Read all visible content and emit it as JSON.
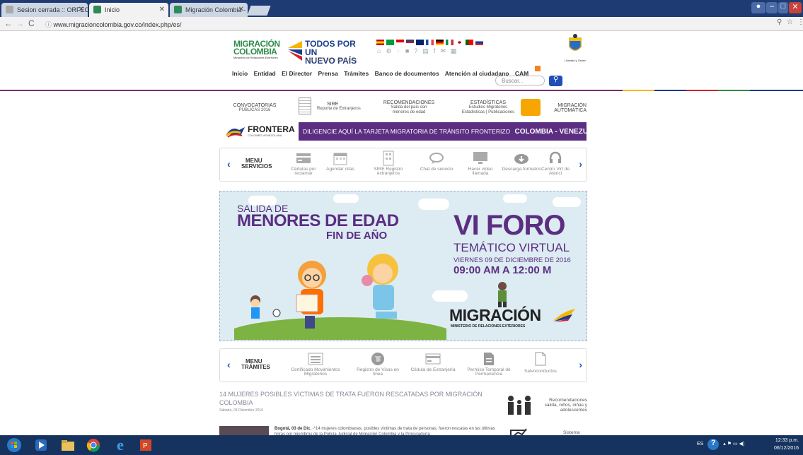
{
  "browser": {
    "tabs": [
      {
        "title": "Sesion cerrada :: ORFEO"
      },
      {
        "title": "Inicio"
      },
      {
        "title": "Migración Colombia - In"
      }
    ],
    "url": "www.migracioncolombia.gov.co/index.php/es/"
  },
  "header": {
    "logo_name": "MIGRACIÓN COLOMBIA",
    "logo_sub": "Ministerio de Relaciones Exteriores",
    "gov_logo_line1": "TODOS POR UN",
    "gov_logo_line2": "NUEVO PAÍS",
    "gov_logo_sub": "PAZ EQUIDAD EDUCACIÓN",
    "shield_caption": "Libertad y Orden"
  },
  "nav": {
    "items": [
      "Inicio",
      "Entidad",
      "El Director",
      "Prensa",
      "Trámites",
      "Banco de documentos",
      "Atención al ciudadano",
      "CAM"
    ],
    "search_placeholder": "Buscar..."
  },
  "quick_links": [
    {
      "title": "CONVOCATORIAS",
      "sub": "PÚBLICAS 2016"
    },
    {
      "title": "SIRE",
      "sub": "Reporte de Extranjeros"
    },
    {
      "title": "RECOMENDACIONES",
      "sub": "Salida del país con menores de edad"
    },
    {
      "title": "ESTADÍSTICAS",
      "sub": "Estudios Migratorios Estadísticas | Publicaciones"
    },
    {
      "title": "MIGRACIÓN",
      "sub": "AUTOMÁTICA"
    }
  ],
  "frontera": {
    "logo": "FRONTERA",
    "logo_sub": "COLOMBO VENEZOLANA",
    "text": "DILIGENCIE AQUÍ LA TARJETA MIGRATORIA DE TRÁNSITO FRONTERIZO",
    "bold": "COLOMBIA - VENEZUELA"
  },
  "services_menu": {
    "label_line1": "MENU",
    "label_line2": "SERVICIOS",
    "items": [
      {
        "label": "Cédulas por reclamar",
        "icon": "card-icon"
      },
      {
        "label": "Agendar citas",
        "icon": "calendar-icon"
      },
      {
        "label": "SIRE Registro extranjeros",
        "icon": "building-icon"
      },
      {
        "label": "Chat de servicio",
        "icon": "chat-icon"
      },
      {
        "label": "Hacer video llamada",
        "icon": "monitor-icon"
      },
      {
        "label": "Descarga formatos",
        "icon": "cloud-download-icon"
      },
      {
        "label": "Centro Virt de Atenci",
        "icon": "headset-icon"
      }
    ]
  },
  "hero": {
    "left_line1": "SALIDA DE",
    "left_line2": "MENORES DE EDAD",
    "left_line3": "FIN DE AÑO",
    "right_line1": "VI FORO",
    "right_line2": "TEMÁTICO VIRTUAL",
    "right_line3": "VIERNES 09 DE DICIEMBRE DE 2016",
    "right_line4": "09:00 AM  A 12:00 M",
    "brand": "MIGRACIÓN",
    "brand_sub": "MINISTERIO DE RELACIONES EXTERIORES"
  },
  "tramites_menu": {
    "label_line1": "MENU",
    "label_line2": "TRÁMITES",
    "items": [
      {
        "label": "Certificado Movimientos Migratorios",
        "icon": "list-icon"
      },
      {
        "label": "Registro de Visas en línea",
        "icon": "globe-icon"
      },
      {
        "label": "Cédula de Extranjería",
        "icon": "card-icon"
      },
      {
        "label": "Permiso Temporal de Permanencia",
        "icon": "document-icon"
      },
      {
        "label": "Salvoconductos",
        "icon": "file-icon"
      }
    ]
  },
  "news": {
    "title": "14 MUJERES POSIBLES VÍCTIMAS DE TRATA FUERON RESCATADAS POR MIGRACIÓN COLOMBIA",
    "date": "Sábado, 03 Diciembre 2016",
    "lead": "Bogotá, 03 de Dic.",
    "body": " -*14 mujeres colombianas, posibles víctimas de trata de personas, fueron rescatas en las últimas horas por miembros de la Policía Judicial de Migración Colombia y la Procuraduría"
  },
  "sidebar": {
    "box1": "Recomendaciones salida, niños, niñas y adolescentes",
    "box2": "Sistema"
  },
  "taskbar": {
    "lang": "ES",
    "time": "12:33 p.m.",
    "date": "06/12/2016"
  }
}
